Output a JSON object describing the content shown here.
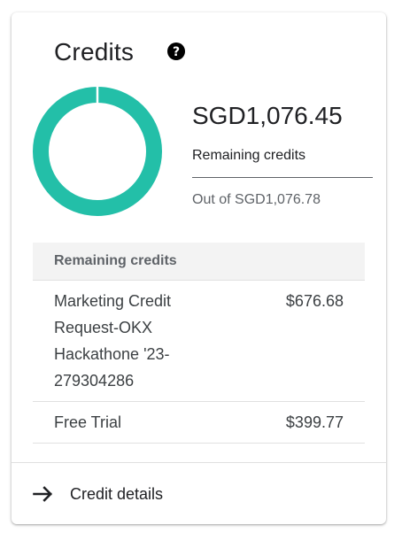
{
  "card": {
    "title": "Credits",
    "help_icon": "help-circle-icon",
    "accent_color": "#23bfa8",
    "remaining_fraction": 0.9997,
    "amount": "SGD1,076.45",
    "remaining_label": "Remaining credits",
    "out_of": "Out of SGD1,076.78"
  },
  "table": {
    "header": "Remaining credits",
    "rows": [
      {
        "name": "Marketing Credit Request-OKX Hackathone '23-279304286",
        "value": "$676.68"
      },
      {
        "name": "Free Trial",
        "value": "$399.77"
      }
    ]
  },
  "footer": {
    "icon": "arrow-right-icon",
    "label": "Credit details"
  }
}
